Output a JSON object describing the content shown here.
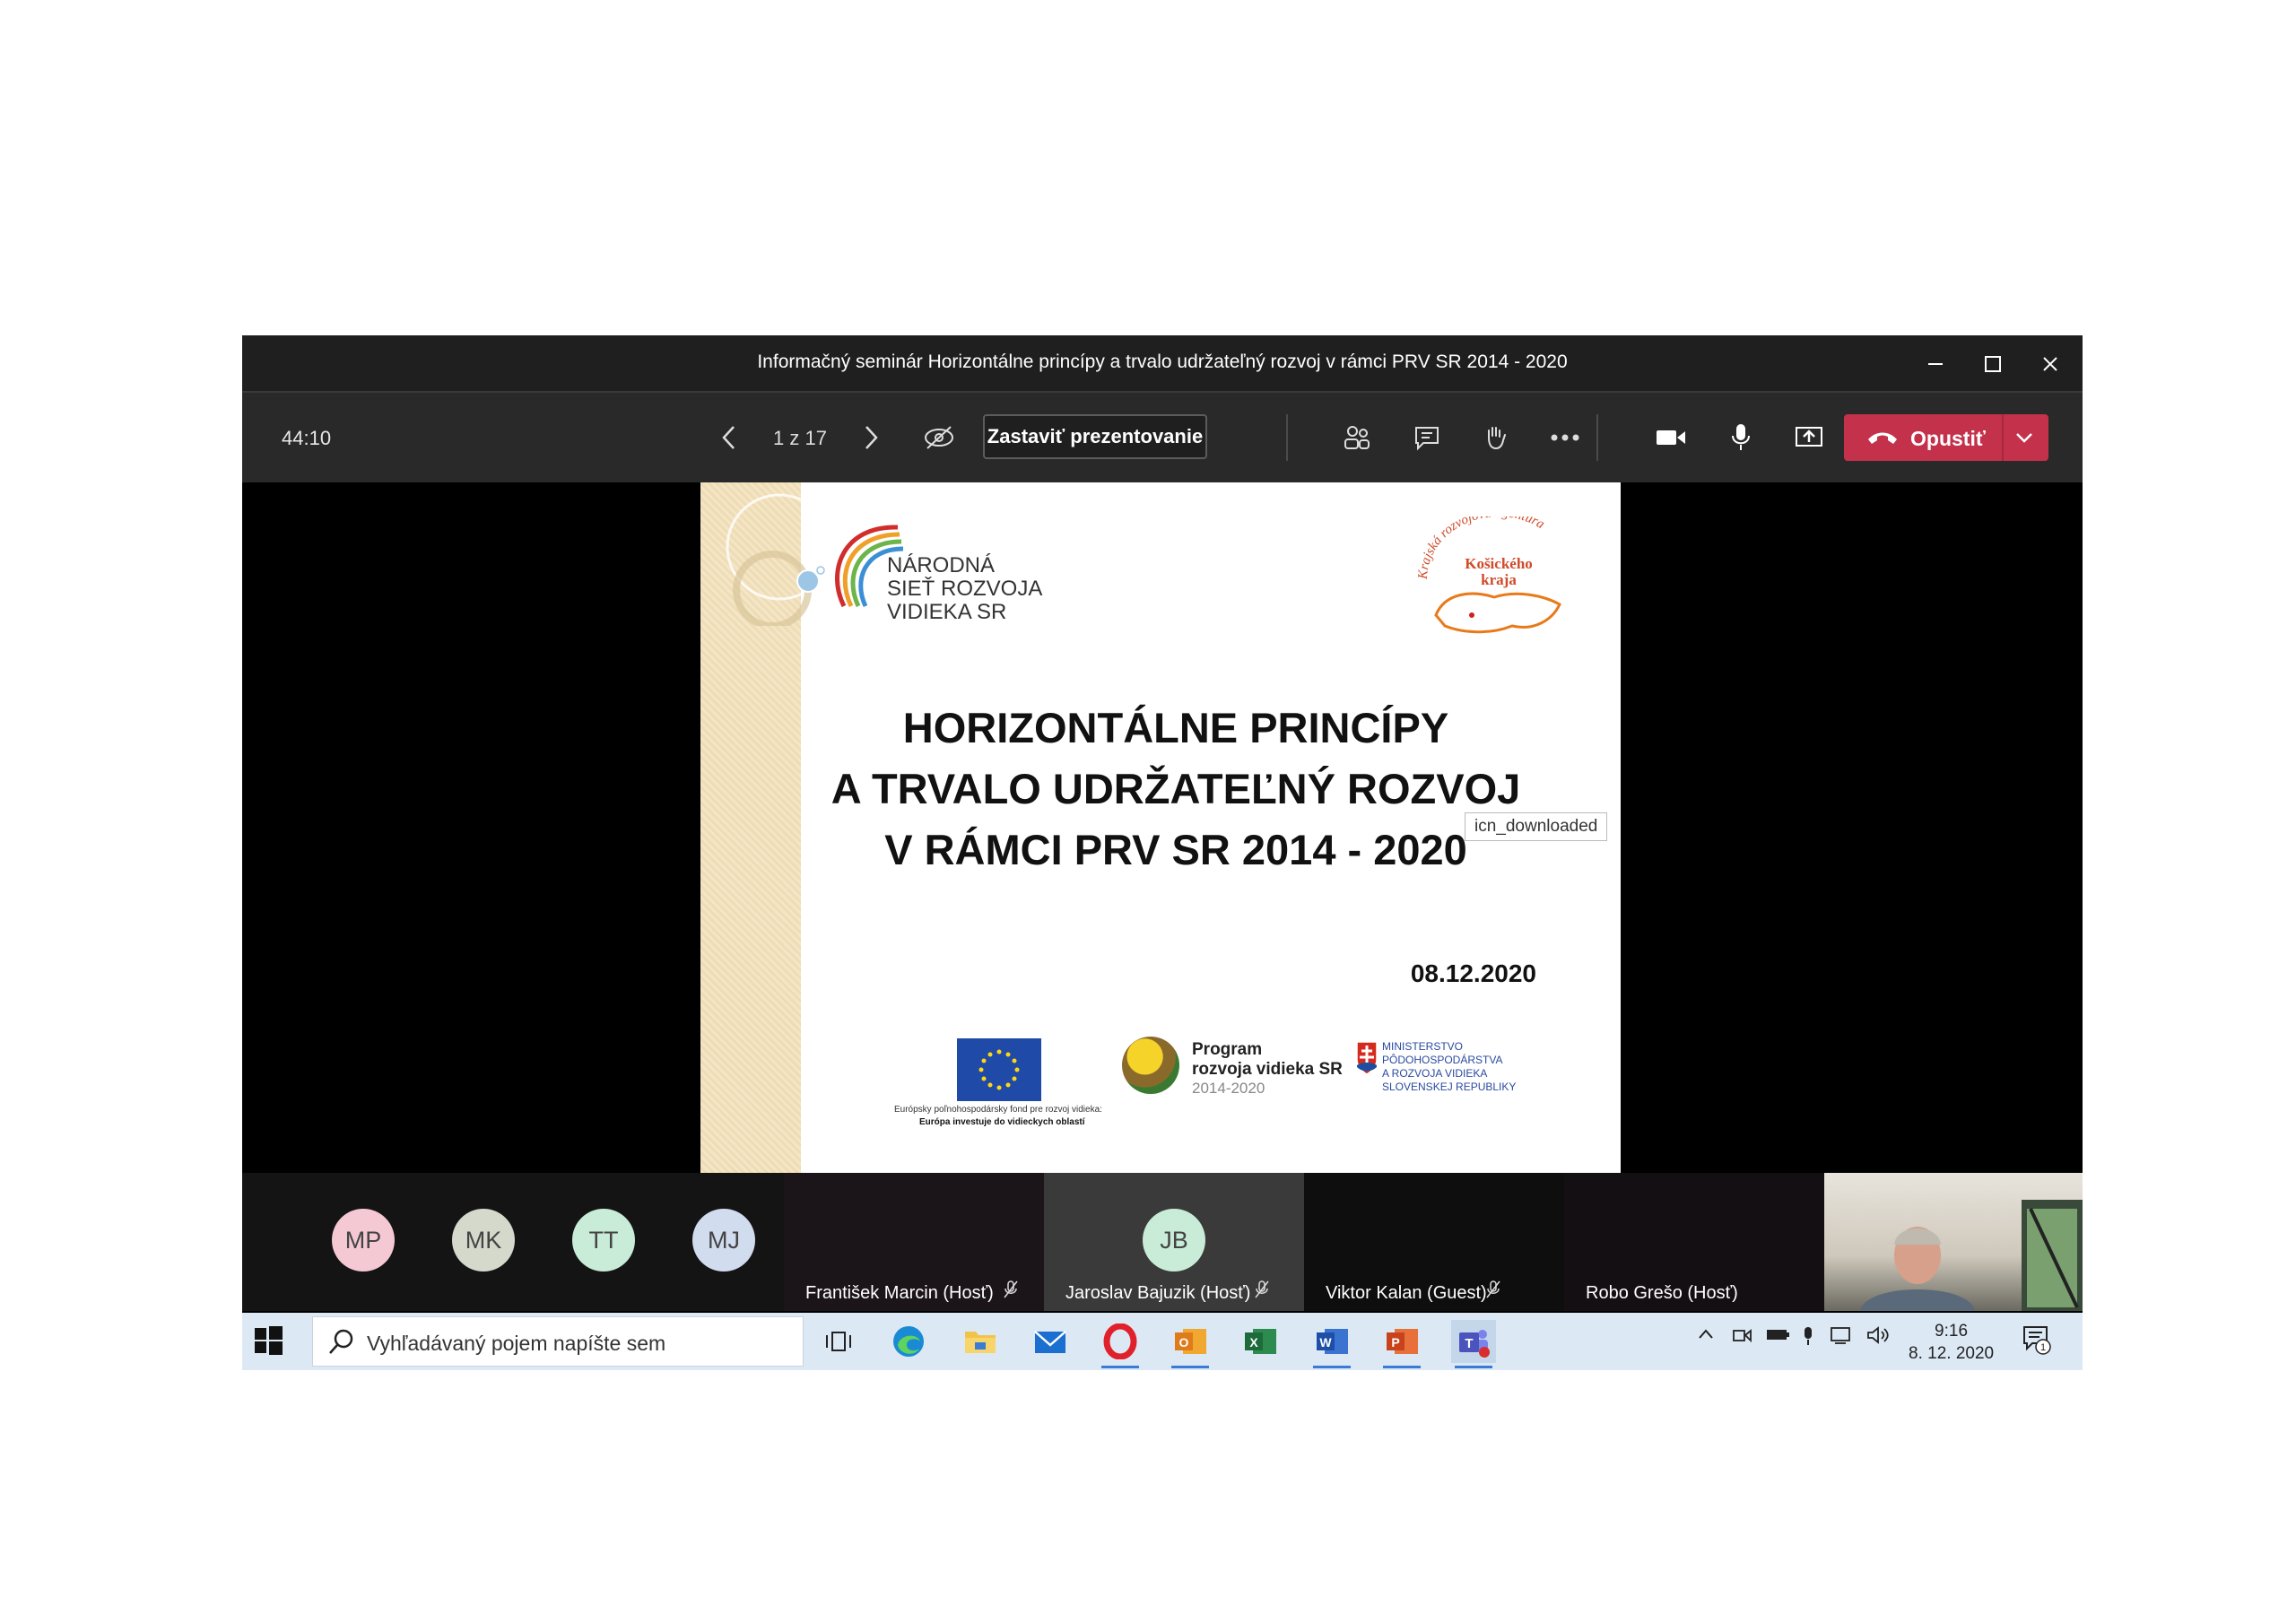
{
  "window": {
    "title": "Informačný seminár Horizontálne princípy a trvalo udržateľný rozvoj v rámci PRV SR 2014 - 2020"
  },
  "toolbar": {
    "timer": "44:10",
    "slide_position": "1 z 17",
    "stop_presenting_label": "Zastaviť prezentovanie",
    "leave_label": "Opustiť",
    "leave_color": "#c4314b"
  },
  "slide": {
    "logo_nsrv_lines": [
      "NÁRODNÁ",
      "SIEŤ ROZVOJA",
      "VIDIEKA SR"
    ],
    "logo_ksk_lines": [
      "Krajská rozvojová agentúra",
      "Košického",
      "kraja"
    ],
    "heading_lines": [
      "HORIZONTÁLNE PRINCÍPY",
      "A TRVALO UDRŽATEĽNÝ ROZVOJ",
      "V RÁMCI PRV SR 2014 - 2020"
    ],
    "date": "08.12.2020",
    "eu_caption_1": "Európsky poľnohospodársky fond pre rozvoj vidieka:",
    "eu_caption_2": "Európa investuje do vidieckych oblastí",
    "prv_lines": [
      "Program",
      "rozvoja vidieka SR",
      "2014-2020"
    ],
    "ministry_lines": [
      "MINISTERSTVO",
      "PÔDOHOSPODÁRSTVA",
      "A ROZVOJA VIDIEKA",
      "SLOVENSKEJ REPUBLIKY"
    ]
  },
  "participants": {
    "avatars": [
      {
        "initials": "MP",
        "color": "#f5c9d4"
      },
      {
        "initials": "MK",
        "color": "#d4d9cc"
      },
      {
        "initials": "TT",
        "color": "#c9ecd8"
      },
      {
        "initials": "MJ",
        "color": "#d2dcef"
      }
    ],
    "tiles": [
      {
        "name": "František Marcin (Hosť)"
      },
      {
        "name": "Jaroslav Bajuzik (Hosť)",
        "initials": "JB",
        "color": "#c9ecd8"
      },
      {
        "name": "Viktor Kalan (Guest)"
      },
      {
        "name": "Robo Grešo (Hosť)"
      }
    ],
    "tooltip": "icn_downloaded"
  },
  "taskbar": {
    "search_placeholder": "Vyhľadávaný pojem napíšte sem",
    "time": "9:16",
    "date": "8. 12. 2020",
    "notification_count": "1"
  }
}
